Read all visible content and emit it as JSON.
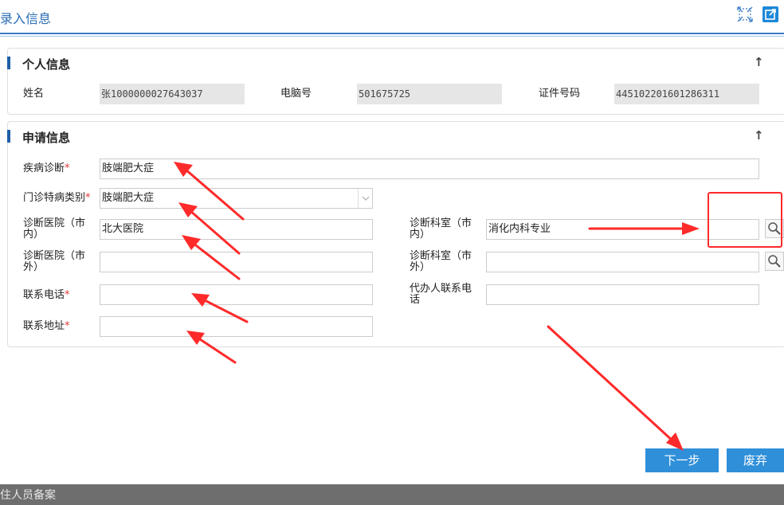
{
  "dialog": {
    "title": "录入信息"
  },
  "personal": {
    "title": "个人信息",
    "name_label": "姓名",
    "name_value": "张1000000027643037",
    "pc_label": "电脑号",
    "pc_value": "501675725",
    "id_label": "证件号码",
    "id_value": "445102201601286311"
  },
  "application": {
    "title": "申请信息",
    "diagnosis_label": "疾病诊断",
    "diagnosis_value": "肢端肥大症",
    "category_label": "门诊特病类别",
    "category_value": "肢端肥大症",
    "hospital_in_label_1": "诊断医院（市",
    "hospital_in_label_2": "内）",
    "hospital_in_value": "北大医院",
    "hospital_out_label_1": "诊断医院（市",
    "hospital_out_label_2": "外）",
    "hospital_out_value": "",
    "dept_in_label_1": "诊断科室（市",
    "dept_in_label_2": "内）",
    "dept_in_value": "消化内科专业",
    "dept_out_label_1": "诊断科室（市",
    "dept_out_label_2": "外）",
    "dept_out_value": "",
    "phone_label": "联系电话",
    "phone_value": "",
    "agent_phone_label_1": "代办人联系电",
    "agent_phone_label_2": "话",
    "agent_phone_value": "",
    "address_label": "联系地址",
    "address_value": "",
    "required_mark": "*"
  },
  "buttons": {
    "next": "下一步",
    "discard": "废弃"
  },
  "footer": {
    "text": "住人员备案"
  },
  "colors": {
    "accent": "#2f8fd9",
    "annotation": "#ff2a2a"
  }
}
